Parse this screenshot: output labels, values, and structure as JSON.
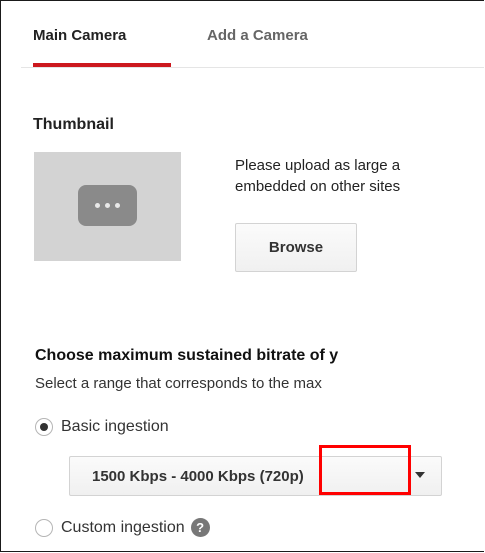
{
  "tabs": [
    {
      "label": "Main Camera",
      "active": true
    },
    {
      "label": "Add a Camera",
      "active": false
    }
  ],
  "thumbnail": {
    "title": "Thumbnail",
    "icon": "more-horizontal-icon",
    "upload_line1": "Please upload as large a",
    "upload_line2": "embedded on other sites",
    "browse_label": "Browse"
  },
  "bitrate": {
    "title": "Choose maximum sustained bitrate of y",
    "description": "Select a range that corresponds to the max",
    "options": [
      {
        "label": "Basic ingestion",
        "selected": true
      },
      {
        "label": "Custom ingestion",
        "selected": false
      }
    ],
    "select_value": "1500 Kbps - 4000 Kbps (720p)",
    "help_icon": "question-mark-icon",
    "help_glyph": "?"
  },
  "colors": {
    "accent": "#cc181e",
    "highlight": "#ff0000"
  }
}
